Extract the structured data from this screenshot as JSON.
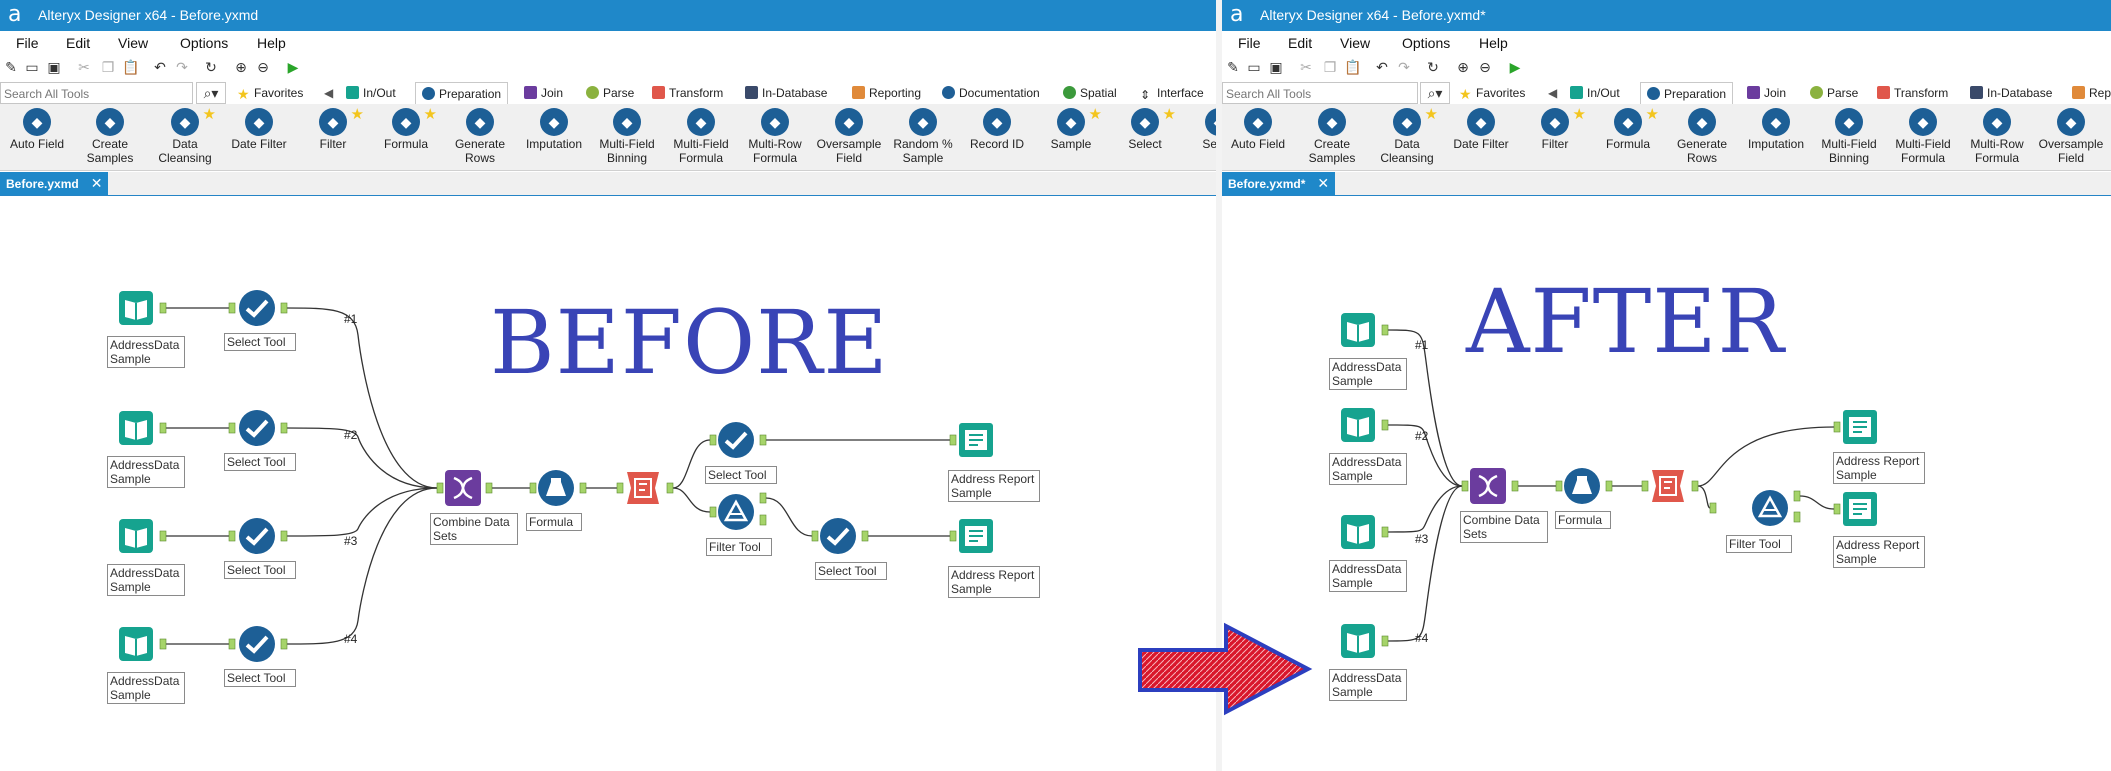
{
  "left": {
    "title": "Alteryx Designer x64 - Before.yxmd",
    "menu": [
      "File",
      "Edit",
      "View",
      "Options",
      "Help"
    ],
    "search_placeholder": "Search All Tools",
    "categories": [
      "Favorites",
      "In/Out",
      "Preparation",
      "Join",
      "Parse",
      "Transform",
      "In-Database",
      "Reporting",
      "Documentation",
      "Spatial",
      "Interface"
    ],
    "tools": [
      "Auto Field",
      "Create Samples",
      "Data Cleansing",
      "Date Filter",
      "Filter",
      "Formula",
      "Generate Rows",
      "Imputation",
      "Multi-Field Binning",
      "Multi-Field Formula",
      "Multi-Row Formula",
      "Oversample Field",
      "Random % Sample",
      "Record ID",
      "Sample",
      "Select",
      "Se Re"
    ],
    "doc_tab": "Before.yxmd",
    "banner": "BEFORE",
    "labels": {
      "input": "AddressData Sample",
      "select": "Select Tool",
      "combine": "Combine Data Sets",
      "formula": "Formula",
      "filter": "Filter Tool",
      "output": "Address Report Sample"
    },
    "tags": [
      "#1",
      "#2",
      "#3",
      "#4"
    ]
  },
  "right": {
    "title": "Alteryx Designer x64 - Before.yxmd*",
    "menu": [
      "File",
      "Edit",
      "View",
      "Options",
      "Help"
    ],
    "search_placeholder": "Search All Tools",
    "categories": [
      "Favorites",
      "In/Out",
      "Preparation",
      "Join",
      "Parse",
      "Transform",
      "In-Database",
      "Rep"
    ],
    "tools": [
      "Auto Field",
      "Create Samples",
      "Data Cleansing",
      "Date Filter",
      "Filter",
      "Formula",
      "Generate Rows",
      "Imputation",
      "Multi-Field Binning",
      "Multi-Field Formula",
      "Multi-Row Formula",
      "Oversample Field"
    ],
    "doc_tab": "Before.yxmd*",
    "banner": "AFTER",
    "labels": {
      "input": "AddressData Sample",
      "combine": "Combine Data Sets",
      "formula": "Formula",
      "filter": "Filter Tool",
      "output": "Address Report Sample"
    },
    "tags": [
      "#1",
      "#2",
      "#3",
      "#4"
    ]
  },
  "colors": {
    "titlebar": "#1f88c9",
    "banner_text": "#3944b6",
    "tool_blue": "#1d5f96",
    "input_teal": "#16a38f",
    "combine_purple": "#6b3c9e",
    "sort_orange": "#e0574b",
    "arrow_red": "#d9162b",
    "arrow_border": "#2c3fbf"
  }
}
